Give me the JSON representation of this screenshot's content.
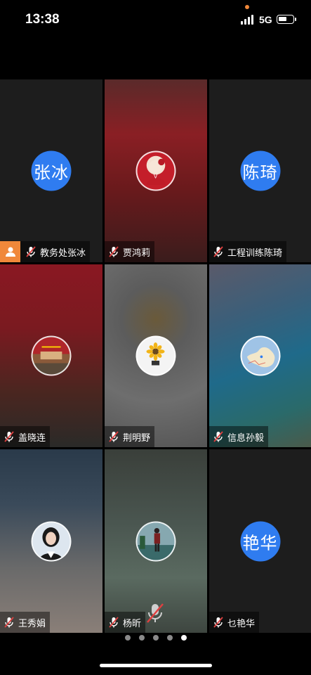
{
  "status": {
    "time": "13:38",
    "network": "5G",
    "battery_level": 0.45,
    "recording_dot_color": "#f0883a"
  },
  "participants": [
    {
      "name": "教务处张冰",
      "avatar_type": "text",
      "avatar_text": "张冰",
      "is_host": true,
      "muted": true
    },
    {
      "name": "贾鸿莉",
      "avatar_type": "photo",
      "avatar_desc": "anime-girl-red",
      "muted": true
    },
    {
      "name": "工程训练陈琦",
      "avatar_type": "text",
      "avatar_text": "陈琦",
      "muted": true
    },
    {
      "name": "盖晓连",
      "avatar_type": "photo",
      "avatar_desc": "red-building",
      "muted": true
    },
    {
      "name": "荆明野",
      "avatar_type": "photo",
      "avatar_desc": "sunflower",
      "muted": true
    },
    {
      "name": "信息孙毅",
      "avatar_type": "photo",
      "avatar_desc": "map",
      "muted": true
    },
    {
      "name": "王秀娟",
      "avatar_type": "photo",
      "avatar_desc": "portrait-woman",
      "muted": true
    },
    {
      "name": "杨昕",
      "avatar_type": "photo",
      "avatar_desc": "person-standing-outdoors",
      "muted": true
    },
    {
      "name": "乜艳华",
      "avatar_type": "text",
      "avatar_text": "艳华",
      "muted": true
    }
  ],
  "pager": {
    "pages": 5,
    "active": 5
  },
  "colors": {
    "avatar_blue": "#2f7cf0",
    "host_orange": "#f0883a"
  },
  "icons": {
    "mic_muted": "mic-muted-icon",
    "host": "host-person-icon"
  }
}
